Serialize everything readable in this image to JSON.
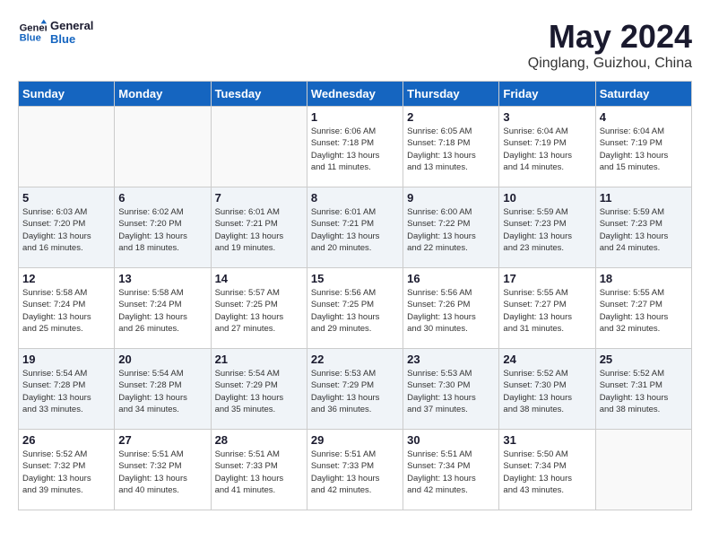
{
  "header": {
    "logo_general": "General",
    "logo_blue": "Blue",
    "month_title": "May 2024",
    "location": "Qinglang, Guizhou, China"
  },
  "days": [
    "Sunday",
    "Monday",
    "Tuesday",
    "Wednesday",
    "Thursday",
    "Friday",
    "Saturday"
  ],
  "weeks": [
    {
      "shade": false,
      "cells": [
        {
          "date": "",
          "info": ""
        },
        {
          "date": "",
          "info": ""
        },
        {
          "date": "",
          "info": ""
        },
        {
          "date": "1",
          "info": "Sunrise: 6:06 AM\nSunset: 7:18 PM\nDaylight: 13 hours\nand 11 minutes."
        },
        {
          "date": "2",
          "info": "Sunrise: 6:05 AM\nSunset: 7:18 PM\nDaylight: 13 hours\nand 13 minutes."
        },
        {
          "date": "3",
          "info": "Sunrise: 6:04 AM\nSunset: 7:19 PM\nDaylight: 13 hours\nand 14 minutes."
        },
        {
          "date": "4",
          "info": "Sunrise: 6:04 AM\nSunset: 7:19 PM\nDaylight: 13 hours\nand 15 minutes."
        }
      ]
    },
    {
      "shade": true,
      "cells": [
        {
          "date": "5",
          "info": "Sunrise: 6:03 AM\nSunset: 7:20 PM\nDaylight: 13 hours\nand 16 minutes."
        },
        {
          "date": "6",
          "info": "Sunrise: 6:02 AM\nSunset: 7:20 PM\nDaylight: 13 hours\nand 18 minutes."
        },
        {
          "date": "7",
          "info": "Sunrise: 6:01 AM\nSunset: 7:21 PM\nDaylight: 13 hours\nand 19 minutes."
        },
        {
          "date": "8",
          "info": "Sunrise: 6:01 AM\nSunset: 7:21 PM\nDaylight: 13 hours\nand 20 minutes."
        },
        {
          "date": "9",
          "info": "Sunrise: 6:00 AM\nSunset: 7:22 PM\nDaylight: 13 hours\nand 22 minutes."
        },
        {
          "date": "10",
          "info": "Sunrise: 5:59 AM\nSunset: 7:23 PM\nDaylight: 13 hours\nand 23 minutes."
        },
        {
          "date": "11",
          "info": "Sunrise: 5:59 AM\nSunset: 7:23 PM\nDaylight: 13 hours\nand 24 minutes."
        }
      ]
    },
    {
      "shade": false,
      "cells": [
        {
          "date": "12",
          "info": "Sunrise: 5:58 AM\nSunset: 7:24 PM\nDaylight: 13 hours\nand 25 minutes."
        },
        {
          "date": "13",
          "info": "Sunrise: 5:58 AM\nSunset: 7:24 PM\nDaylight: 13 hours\nand 26 minutes."
        },
        {
          "date": "14",
          "info": "Sunrise: 5:57 AM\nSunset: 7:25 PM\nDaylight: 13 hours\nand 27 minutes."
        },
        {
          "date": "15",
          "info": "Sunrise: 5:56 AM\nSunset: 7:25 PM\nDaylight: 13 hours\nand 29 minutes."
        },
        {
          "date": "16",
          "info": "Sunrise: 5:56 AM\nSunset: 7:26 PM\nDaylight: 13 hours\nand 30 minutes."
        },
        {
          "date": "17",
          "info": "Sunrise: 5:55 AM\nSunset: 7:27 PM\nDaylight: 13 hours\nand 31 minutes."
        },
        {
          "date": "18",
          "info": "Sunrise: 5:55 AM\nSunset: 7:27 PM\nDaylight: 13 hours\nand 32 minutes."
        }
      ]
    },
    {
      "shade": true,
      "cells": [
        {
          "date": "19",
          "info": "Sunrise: 5:54 AM\nSunset: 7:28 PM\nDaylight: 13 hours\nand 33 minutes."
        },
        {
          "date": "20",
          "info": "Sunrise: 5:54 AM\nSunset: 7:28 PM\nDaylight: 13 hours\nand 34 minutes."
        },
        {
          "date": "21",
          "info": "Sunrise: 5:54 AM\nSunset: 7:29 PM\nDaylight: 13 hours\nand 35 minutes."
        },
        {
          "date": "22",
          "info": "Sunrise: 5:53 AM\nSunset: 7:29 PM\nDaylight: 13 hours\nand 36 minutes."
        },
        {
          "date": "23",
          "info": "Sunrise: 5:53 AM\nSunset: 7:30 PM\nDaylight: 13 hours\nand 37 minutes."
        },
        {
          "date": "24",
          "info": "Sunrise: 5:52 AM\nSunset: 7:30 PM\nDaylight: 13 hours\nand 38 minutes."
        },
        {
          "date": "25",
          "info": "Sunrise: 5:52 AM\nSunset: 7:31 PM\nDaylight: 13 hours\nand 38 minutes."
        }
      ]
    },
    {
      "shade": false,
      "cells": [
        {
          "date": "26",
          "info": "Sunrise: 5:52 AM\nSunset: 7:32 PM\nDaylight: 13 hours\nand 39 minutes."
        },
        {
          "date": "27",
          "info": "Sunrise: 5:51 AM\nSunset: 7:32 PM\nDaylight: 13 hours\nand 40 minutes."
        },
        {
          "date": "28",
          "info": "Sunrise: 5:51 AM\nSunset: 7:33 PM\nDaylight: 13 hours\nand 41 minutes."
        },
        {
          "date": "29",
          "info": "Sunrise: 5:51 AM\nSunset: 7:33 PM\nDaylight: 13 hours\nand 42 minutes."
        },
        {
          "date": "30",
          "info": "Sunrise: 5:51 AM\nSunset: 7:34 PM\nDaylight: 13 hours\nand 42 minutes."
        },
        {
          "date": "31",
          "info": "Sunrise: 5:50 AM\nSunset: 7:34 PM\nDaylight: 13 hours\nand 43 minutes."
        },
        {
          "date": "",
          "info": ""
        }
      ]
    }
  ]
}
